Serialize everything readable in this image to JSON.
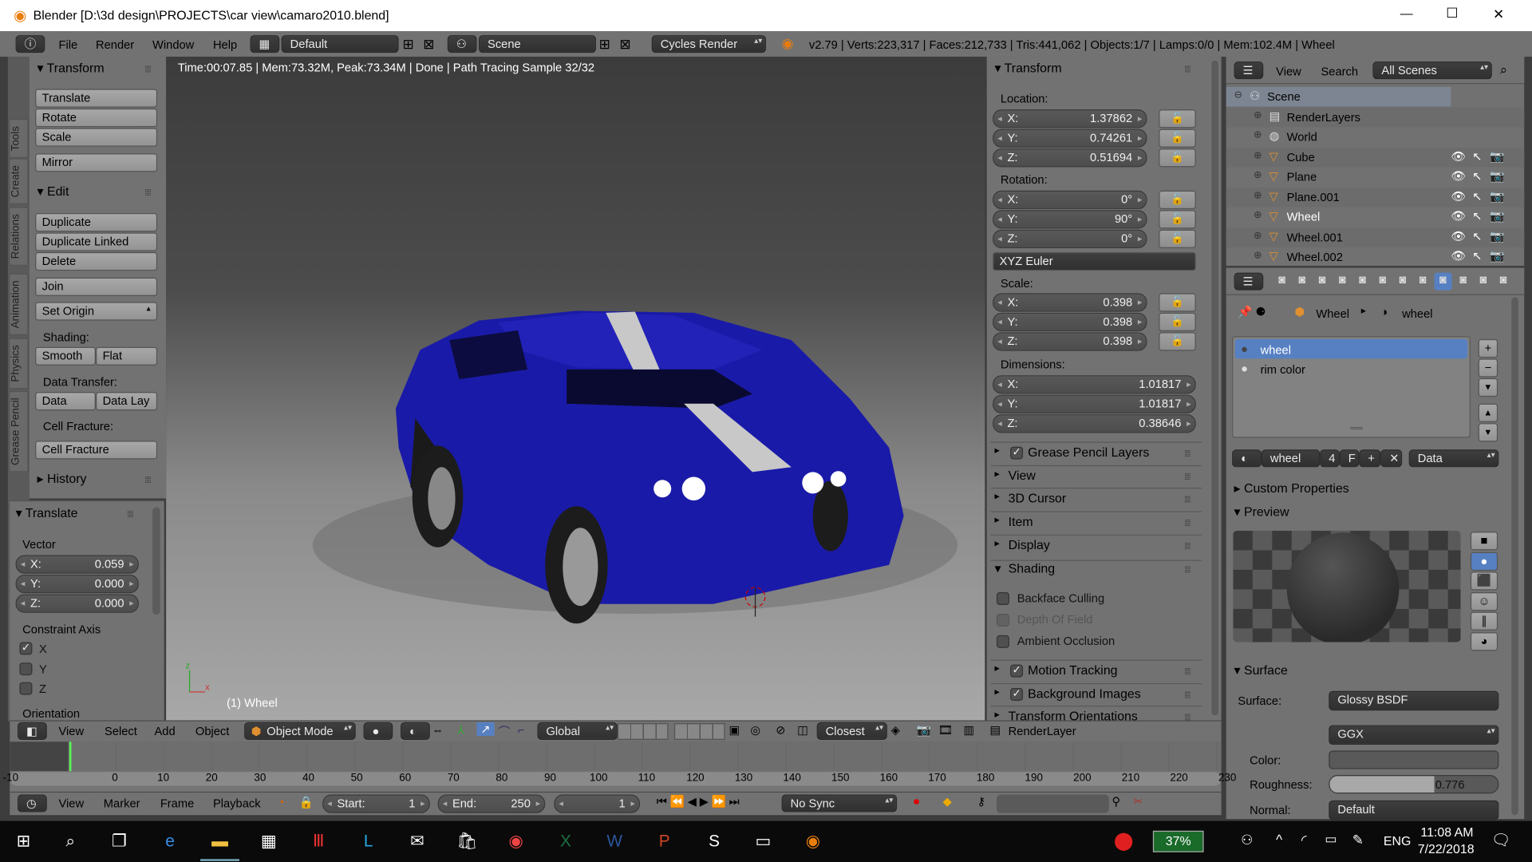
{
  "window": {
    "title": "Blender [D:\\3d design\\PROJECTS\\car view\\camaro2010.blend]",
    "minimize": "—",
    "maximize": "☐",
    "close": "✕"
  },
  "infobar": {
    "menus": [
      "File",
      "Render",
      "Window",
      "Help"
    ],
    "layout": "Default",
    "scene": "Scene",
    "engine": "Cycles Render",
    "stats": "v2.79 | Verts:223,317 | Faces:212,733 | Tris:441,062 | Objects:1/7 | Lamps:0/0 | Mem:102.4M | Wheel"
  },
  "viewport": {
    "render_info": "Time:00:07.85 | Mem:73.32M, Peak:73.34M | Done | Path Tracing Sample 32/32",
    "object_label": "(1) Wheel",
    "colors": {
      "body": "#1a1aa8",
      "stripe": "#c8c8c8"
    }
  },
  "toolshelf": {
    "tabs": [
      "Tools",
      "Create",
      "Relations",
      "Animation",
      "Physics",
      "Grease Pencil"
    ],
    "transform_header": "Transform",
    "translate": "Translate",
    "rotate": "Rotate",
    "scale": "Scale",
    "mirror": "Mirror",
    "edit_header": "Edit",
    "duplicate": "Duplicate",
    "duplicate_linked": "Duplicate Linked",
    "delete": "Delete",
    "join": "Join",
    "set_origin": "Set Origin",
    "shading_label": "Shading:",
    "smooth": "Smooth",
    "flat": "Flat",
    "data_transfer_label": "Data Transfer:",
    "data": "Data",
    "data_lay": "Data Lay",
    "cell_fracture_label": "Cell Fracture:",
    "cell_fracture": "Cell Fracture",
    "history_header": "History"
  },
  "operator": {
    "header": "Translate",
    "vector_label": "Vector",
    "x": {
      "label": "X:",
      "value": "0.059"
    },
    "y": {
      "label": "Y:",
      "value": "0.000"
    },
    "z": {
      "label": "Z:",
      "value": "0.000"
    },
    "constraint_label": "Constraint Axis",
    "axes": [
      {
        "label": "X",
        "checked": true
      },
      {
        "label": "Y",
        "checked": false
      },
      {
        "label": "Z",
        "checked": false
      }
    ],
    "orientation_label": "Orientation"
  },
  "npanel": {
    "transform_header": "Transform",
    "location_label": "Location:",
    "location": [
      {
        "label": "X:",
        "value": "1.37862"
      },
      {
        "label": "Y:",
        "value": "0.74261"
      },
      {
        "label": "Z:",
        "value": "0.51694"
      }
    ],
    "rotation_label": "Rotation:",
    "rotation": [
      {
        "label": "X:",
        "value": "0°"
      },
      {
        "label": "Y:",
        "value": "90°"
      },
      {
        "label": "Z:",
        "value": "0°"
      }
    ],
    "rotation_mode": "XYZ Euler",
    "scale_label": "Scale:",
    "scale": [
      {
        "label": "X:",
        "value": "0.398"
      },
      {
        "label": "Y:",
        "value": "0.398"
      },
      {
        "label": "Z:",
        "value": "0.398"
      }
    ],
    "dimensions_label": "Dimensions:",
    "dimensions": [
      {
        "label": "X:",
        "value": "1.01817"
      },
      {
        "label": "Y:",
        "value": "1.01817"
      },
      {
        "label": "Z:",
        "value": "0.38646"
      }
    ],
    "panels_a": [
      {
        "label": "Grease Pencil Layers",
        "check": true
      },
      {
        "label": "View"
      },
      {
        "label": "3D Cursor"
      },
      {
        "label": "Item"
      },
      {
        "label": "Display"
      }
    ],
    "shading_header": "Shading",
    "shading_opts": [
      {
        "label": "Backface Culling",
        "dim": false
      },
      {
        "label": "Depth Of Field",
        "dim": true
      },
      {
        "label": "Ambient Occlusion",
        "dim": false
      }
    ],
    "panels_b": [
      {
        "label": "Motion Tracking",
        "check": true
      },
      {
        "label": "Background Images",
        "check": true
      },
      {
        "label": "Transform Orientations"
      }
    ]
  },
  "outliner": {
    "view": "View",
    "search": "Search",
    "filter": "All Scenes",
    "rows": [
      {
        "label": "Scene",
        "level": 0,
        "icon": "scene"
      },
      {
        "label": "RenderLayers",
        "level": 1,
        "icon": "renderlayers"
      },
      {
        "label": "World",
        "level": 1,
        "icon": "world"
      },
      {
        "label": "Cube",
        "level": 1,
        "icon": "mesh"
      },
      {
        "label": "Plane",
        "level": 1,
        "icon": "mesh"
      },
      {
        "label": "Plane.001",
        "level": 1,
        "icon": "mesh"
      },
      {
        "label": "Wheel",
        "level": 1,
        "icon": "mesh",
        "active": true
      },
      {
        "label": "Wheel.001",
        "level": 1,
        "icon": "mesh"
      },
      {
        "label": "Wheel.002",
        "level": 1,
        "icon": "mesh"
      }
    ]
  },
  "properties": {
    "breadcrumb": {
      "object": "Wheel",
      "material": "wheel"
    },
    "materials": [
      {
        "label": "wheel",
        "selected": true
      },
      {
        "label": "rim color",
        "selected": false
      }
    ],
    "slot": {
      "name": "wheel",
      "users": "4",
      "fake": "F",
      "link": "Data"
    },
    "custom_props": "Custom Properties",
    "preview": "Preview",
    "surface_header": "Surface",
    "surface_label": "Surface:",
    "surface_value": "Glossy BSDF",
    "distribution": "GGX",
    "color_label": "Color:",
    "roughness_label": "Roughness:",
    "roughness": "0.776",
    "roughness_fraction": 0.776,
    "normal_label": "Normal:",
    "normal_value": "Default",
    "accent": "#5680c2"
  },
  "view3d_header": {
    "menus": [
      "View",
      "Select",
      "Add",
      "Object"
    ],
    "mode": "Object Mode",
    "orientation": "Global",
    "snap": "Closest",
    "layer": "RenderLayer"
  },
  "timeline": {
    "ticks": [
      "-10",
      "0",
      "10",
      "20",
      "30",
      "40",
      "50",
      "60",
      "70",
      "80",
      "90",
      "100",
      "110",
      "120",
      "130",
      "140",
      "150",
      "160",
      "170",
      "180",
      "190",
      "200",
      "210",
      "220",
      "230"
    ],
    "current_frame_marker": 0
  },
  "timeline_header": {
    "menus": [
      "View",
      "Marker",
      "Frame",
      "Playback"
    ],
    "start_label": "Start:",
    "start": "1",
    "end_label": "End:",
    "end": "250",
    "current": "1",
    "sync": "No Sync"
  },
  "taskbar": {
    "apps": [
      "start",
      "search",
      "task-view",
      "edge",
      "file-explorer",
      "calculator",
      "red-app",
      "l-app",
      "mail",
      "store",
      "chrome",
      "excel",
      "word",
      "powerpoint",
      "skype",
      "remote-desktop",
      "blender"
    ],
    "battery_badge": "37%",
    "language": "ENG",
    "time": "11:08 AM",
    "date": "7/22/2018"
  }
}
